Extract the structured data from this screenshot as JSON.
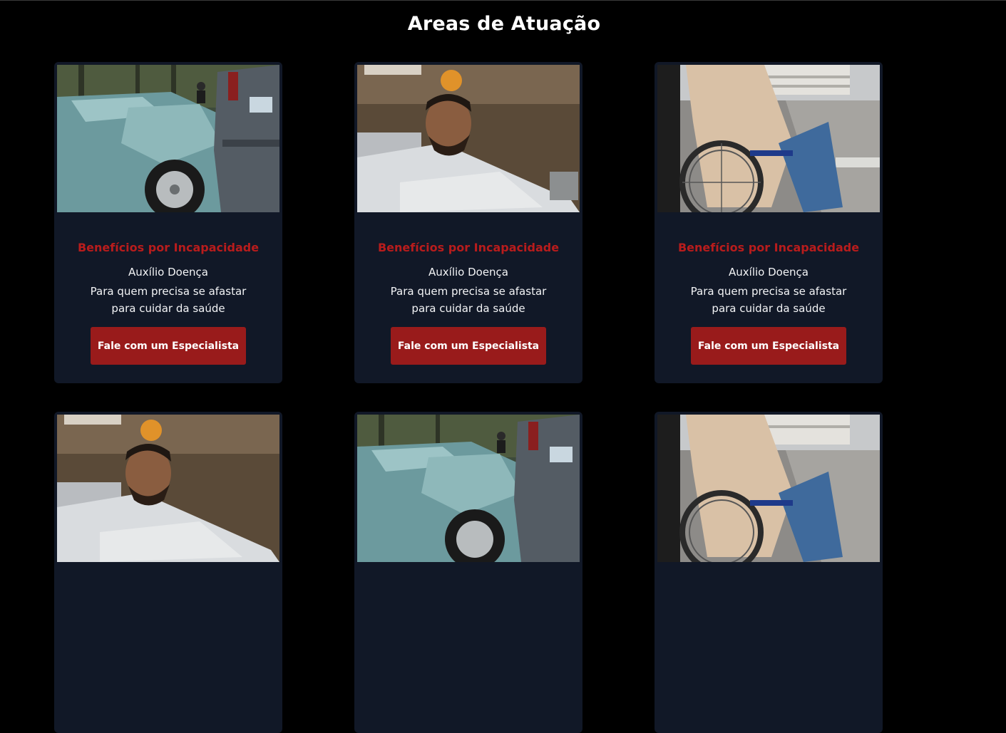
{
  "section": {
    "title": "Areas de Atuação"
  },
  "cards": [
    {
      "image": "car-accident-photo",
      "title": "Benefícios por Incapacidade",
      "subtitle": "Auxílio Doença",
      "description": "Para quem precisa se afastar para cuidar da saúde",
      "button": "Fale com um Especialista"
    },
    {
      "image": "hospital-patient-photo",
      "title": "Benefícios por Incapacidade",
      "subtitle": "Auxílio Doença",
      "description": "Para quem precisa se afastar para cuidar da saúde",
      "button": "Fale com um Especialista"
    },
    {
      "image": "wheelchair-photo",
      "title": "Benefícios por Incapacidade",
      "subtitle": "Auxílio Doença",
      "description": "Para quem precisa se afastar para cuidar da saúde",
      "button": "Fale com um Especialista"
    },
    {
      "image": "hospital-patient-photo"
    },
    {
      "image": "car-accident-photo"
    },
    {
      "image": "wheelchair-photo"
    }
  ],
  "colors": {
    "page_background": "#000000",
    "card_background": "#111827",
    "title_red": "#b91c1c",
    "button_red": "#991b1b"
  }
}
